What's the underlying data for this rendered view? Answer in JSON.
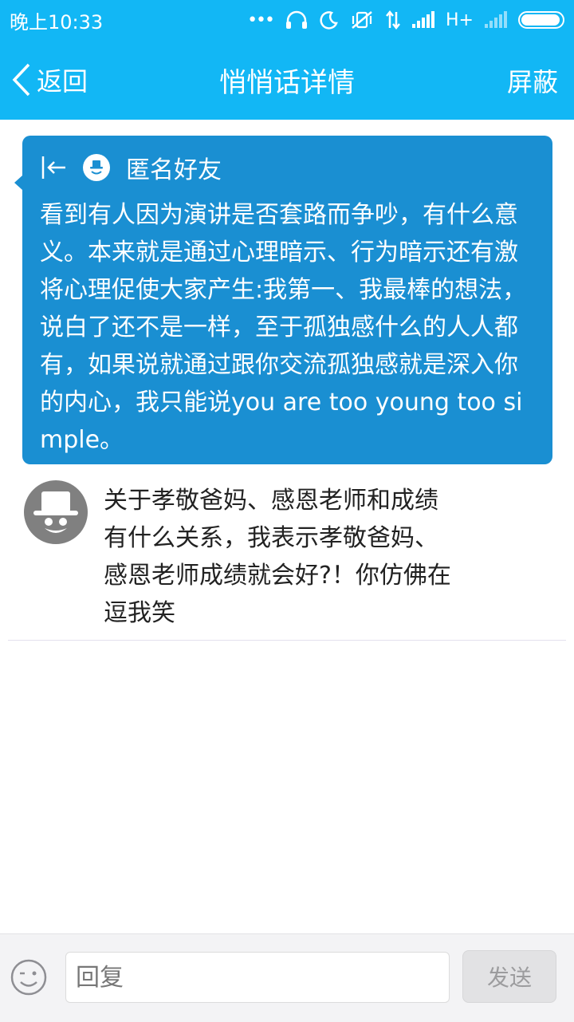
{
  "status_bar": {
    "time": "晚上10:33",
    "dots": "•••",
    "network": "H+",
    "battery_level": 0.95,
    "icons": [
      "headphones-icon",
      "moon-icon",
      "vibrate-off-icon",
      "data-arrows-icon",
      "signal-icon",
      "signal-icon-2",
      "battery-icon"
    ]
  },
  "nav": {
    "back_label": "返回",
    "title": "悄悄话详情",
    "block_label": "屏蔽"
  },
  "message": {
    "sender": "匿名好友",
    "text": "看到有人因为演讲是否套路而争吵，有什么意义。本来就是通过心理暗示、行为暗示还有激将心理促使大家产生:我第一、我最棒的想法，说白了还不是一样，至于孤独感什么的人人都有，如果说就通过跟你交流孤独感就是深入你的内心，我只能说you are too young too simple。",
    "bubble_color": "#1a8fd2"
  },
  "reply": {
    "text": "关于孝敬爸妈、感恩老师和成绩有什么关系，我表示孝敬爸妈、感恩老师成绩就会好?！你仿佛在逗我笑"
  },
  "composer": {
    "placeholder": "回复",
    "send_label": "发送"
  },
  "colors": {
    "accent": "#12b7f5"
  }
}
